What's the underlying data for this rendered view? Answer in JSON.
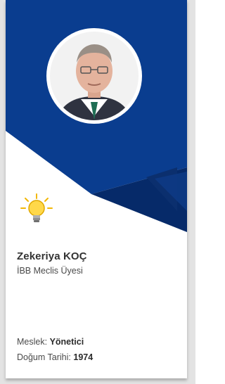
{
  "profile": {
    "name": "Zekeriya KOÇ",
    "title": "İBB Meclis Üyesi",
    "profession_label": "Meslek:",
    "profession_value": "Yönetici",
    "birth_label": "Doğum Tarihi:",
    "birth_value": "1974"
  },
  "icons": {
    "badge": "lightbulb-icon",
    "photo": "portrait-photo"
  },
  "colors": {
    "banner_blue": "#0a3d8f",
    "banner_blue_dark": "#062a69",
    "card_bg": "#ffffff",
    "page_bg": "#e3e3e3",
    "text": "#333333"
  }
}
